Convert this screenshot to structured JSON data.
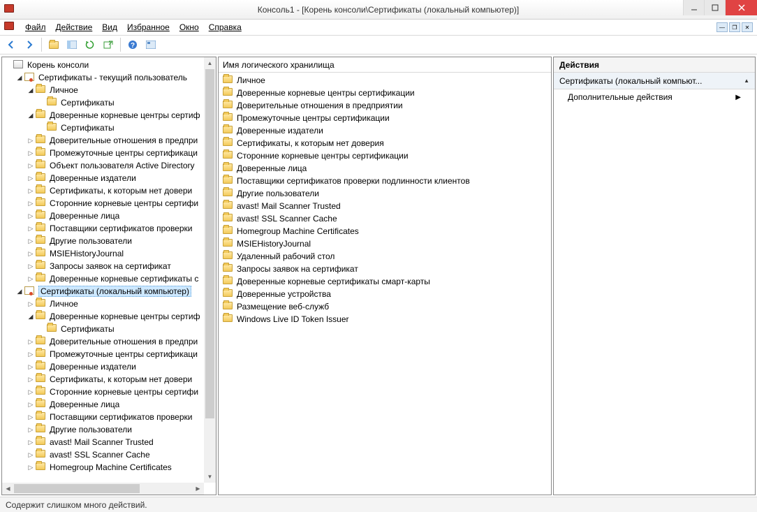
{
  "window": {
    "title": "Консоль1 - [Корень консоли\\Сертификаты (локальный компьютер)]"
  },
  "menu": {
    "file": "Файл",
    "action": "Действие",
    "view": "Вид",
    "favorites": "Избранное",
    "window": "Окно",
    "help": "Справка"
  },
  "tree": {
    "root": "Корень консоли",
    "user_certs": "Сертификаты - текущий пользователь",
    "user_items": {
      "personal": "Личное",
      "certs_sub": "Сертификаты",
      "trusted_root": "Доверенные корневые центры сертиф",
      "enterprise_trust": "Доверительные отношения в предпри",
      "intermediate": "Промежуточные центры сертификаци",
      "ad_user_obj": "Объект пользователя Active Directory",
      "trusted_publishers": "Доверенные издатели",
      "untrusted": "Сертификаты, к которым нет довери",
      "third_party_root": "Сторонние корневые центры сертифи",
      "trusted_people": "Доверенные лица",
      "client_auth": "Поставщики сертификатов проверки",
      "other_people": "Другие пользователи",
      "msie": "MSIEHistoryJournal",
      "cert_requests": "Запросы заявок на сертификат",
      "smartcard_root": "Доверенные корневые сертификаты с"
    },
    "computer_certs": "Сертификаты (локальный компьютер)",
    "computer_items": {
      "personal": "Личное",
      "trusted_root": "Доверенные корневые центры сертиф",
      "certs_sub": "Сертификаты",
      "enterprise_trust": "Доверительные отношения в предпри",
      "intermediate": "Промежуточные центры сертификаци",
      "trusted_publishers": "Доверенные издатели",
      "untrusted": "Сертификаты, к которым нет довери",
      "third_party_root": "Сторонние корневые центры сертифи",
      "trusted_people": "Доверенные лица",
      "client_auth": "Поставщики сертификатов проверки",
      "other_people": "Другие пользователи",
      "avast_mail": "avast! Mail Scanner Trusted",
      "avast_ssl": "avast! SSL Scanner Cache",
      "homegroup": "Homegroup Machine Certificates"
    }
  },
  "list": {
    "header": "Имя логического хранилища",
    "rows": [
      "Личное",
      "Доверенные корневые центры сертификации",
      "Доверительные отношения в предприятии",
      "Промежуточные центры сертификации",
      "Доверенные издатели",
      "Сертификаты, к которым нет доверия",
      "Сторонние корневые центры сертификации",
      "Доверенные лица",
      "Поставщики сертификатов проверки подлинности клиентов",
      "Другие пользователи",
      "avast! Mail Scanner Trusted",
      "avast! SSL Scanner Cache",
      "Homegroup Machine Certificates",
      "MSIEHistoryJournal",
      "Удаленный рабочий стол",
      "Запросы заявок на сертификат",
      "Доверенные корневые сертификаты смарт-карты",
      "Доверенные устройства",
      "Размещение веб-служб",
      "Windows Live ID Token Issuer"
    ]
  },
  "actions": {
    "header": "Действия",
    "selection": "Сертификаты (локальный компьют...",
    "more": "Дополнительные действия"
  },
  "status": {
    "text": "Содержит слишком много действий."
  }
}
